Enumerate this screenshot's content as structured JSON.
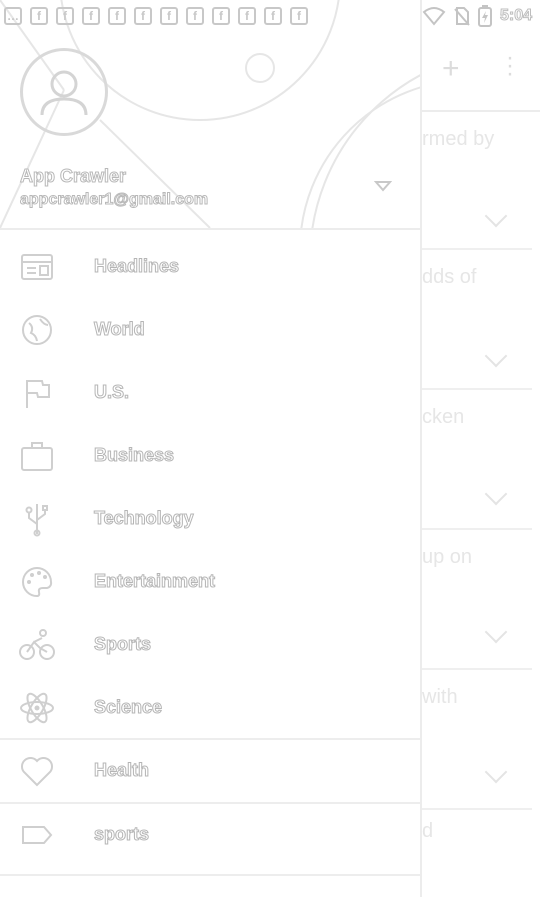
{
  "status_bar": {
    "notification_icons": [
      "…",
      "f",
      "f",
      "f",
      "f",
      "f",
      "f",
      "f",
      "f",
      "f",
      "f",
      "f"
    ],
    "time": "5:04"
  },
  "drawer": {
    "account": {
      "name": "App Crawler",
      "email": "appcrawler1@gmail.com"
    },
    "items": [
      {
        "label": "Headlines",
        "icon": "headlines-icon"
      },
      {
        "label": "World",
        "icon": "globe-icon"
      },
      {
        "label": "U.S.",
        "icon": "flag-icon"
      },
      {
        "label": "Business",
        "icon": "briefcase-icon"
      },
      {
        "label": "Technology",
        "icon": "usb-icon"
      },
      {
        "label": "Entertainment",
        "icon": "palette-icon"
      },
      {
        "label": "Sports",
        "icon": "bicycle-icon"
      },
      {
        "label": "Science",
        "icon": "atom-icon"
      },
      {
        "label": "Health",
        "icon": "heart-icon"
      },
      {
        "label": "sports",
        "icon": "label-icon"
      }
    ]
  },
  "background": {
    "cards": [
      {
        "text": "rmed by"
      },
      {
        "text": "dds of"
      },
      {
        "text": "cken"
      },
      {
        "text": "up on"
      },
      {
        "text": "with"
      },
      {
        "text": "d"
      }
    ]
  },
  "colors": {
    "background": "#ffffff",
    "outline": "#d0d0d0"
  }
}
